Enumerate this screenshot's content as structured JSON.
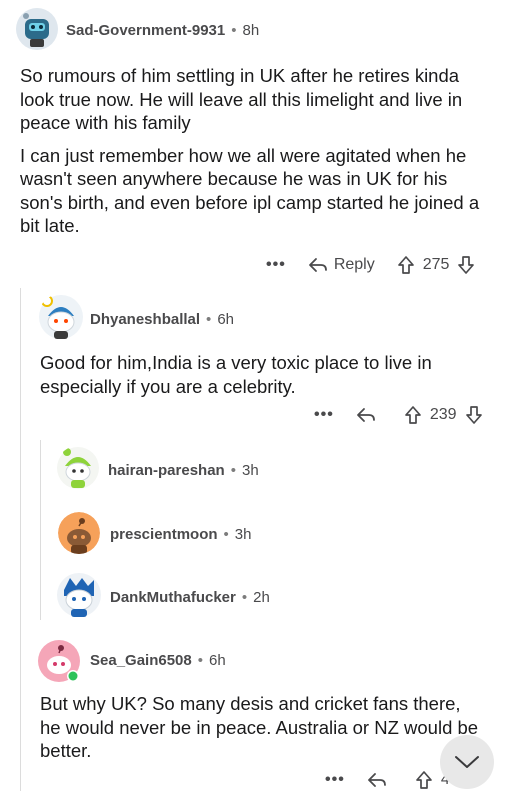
{
  "comments": [
    {
      "username": "Sad-Government-9931",
      "age": "8h",
      "paragraphs": [
        "So rumours of him settling in UK after he retires kinda look true now. He will leave all this limelight and live in peace with his family",
        "I can just remember how we all were agitated when he wasn't seen anywhere because he was in UK for his son's birth, and even before ipl camp started he joined a bit late."
      ],
      "reply_label": "Reply",
      "score": "275"
    },
    {
      "username": "Dhyaneshballal",
      "age": "6h",
      "paragraphs": [
        "Good for him,India is a very toxic place to live in especially if you are a celebrity."
      ],
      "score": "239"
    },
    {
      "username": "hairan-pareshan",
      "age": "3h"
    },
    {
      "username": "prescientmoon",
      "age": "3h"
    },
    {
      "username": "DankMuthafucker",
      "age": "2h"
    },
    {
      "username": "Sea_Gain6508",
      "age": "6h",
      "paragraphs": [
        "But why UK? So many desis and cricket fans there, he would never be in peace. Australia or NZ would be better."
      ],
      "score": "4"
    }
  ],
  "more_label": "•••",
  "separator": "•"
}
